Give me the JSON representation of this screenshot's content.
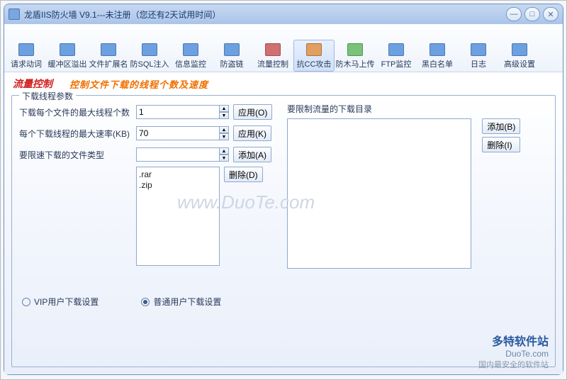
{
  "window": {
    "title": "龙盾IIS防火墙 V9.1---未注册（您还有2天试用时间）"
  },
  "toolbar": [
    {
      "label": "请求动词",
      "iconClass": "blue"
    },
    {
      "label": "缓冲区溢出",
      "iconClass": "blue"
    },
    {
      "label": "文件扩展名",
      "iconClass": "blue"
    },
    {
      "label": "防SQL注入",
      "iconClass": "blue"
    },
    {
      "label": "信息监控",
      "iconClass": "blue"
    },
    {
      "label": "防盗链",
      "iconClass": "blue"
    },
    {
      "label": "流量控制",
      "iconClass": "red"
    },
    {
      "label": "抗CC攻击",
      "iconClass": "orange",
      "active": true
    },
    {
      "label": "防木马上传",
      "iconClass": "green"
    },
    {
      "label": "FTP监控",
      "iconClass": "blue"
    },
    {
      "label": "黑白名单",
      "iconClass": "blue"
    },
    {
      "label": "日志",
      "iconClass": "blue"
    },
    {
      "label": "高级设置",
      "iconClass": "blue"
    }
  ],
  "subtitle": {
    "left": "流量控制",
    "right": "控制文件下载的线程个数及速度"
  },
  "group": {
    "legend": "下载线程参数"
  },
  "form": {
    "row1_label": "下载每个文件的最大线程个数",
    "row1_value": "1",
    "row1_btn": "应用(O)",
    "row2_label": "每个下载线程的最大速率(KB)",
    "row2_value": "70",
    "row2_btn": "应用(K)",
    "row3_label": "要限速下载的文件类型",
    "row3_value": "",
    "row3_btn": "添加(A)",
    "row4_btn": "删除(D)",
    "filetypes": [
      ".rar",
      ".zip"
    ]
  },
  "right": {
    "label": "要限制流量的下载目录",
    "add_btn": "添加(B)",
    "del_btn": "删除(I)"
  },
  "radios": {
    "vip": "VIP用户下载设置",
    "normal": "普通用户下载设置",
    "selected": "normal"
  },
  "watermark": "www.DuoTe.com",
  "footer": {
    "line1": "多特软件站",
    "line2": "DuoTe.com",
    "line3": "国内最安全的软件站"
  }
}
